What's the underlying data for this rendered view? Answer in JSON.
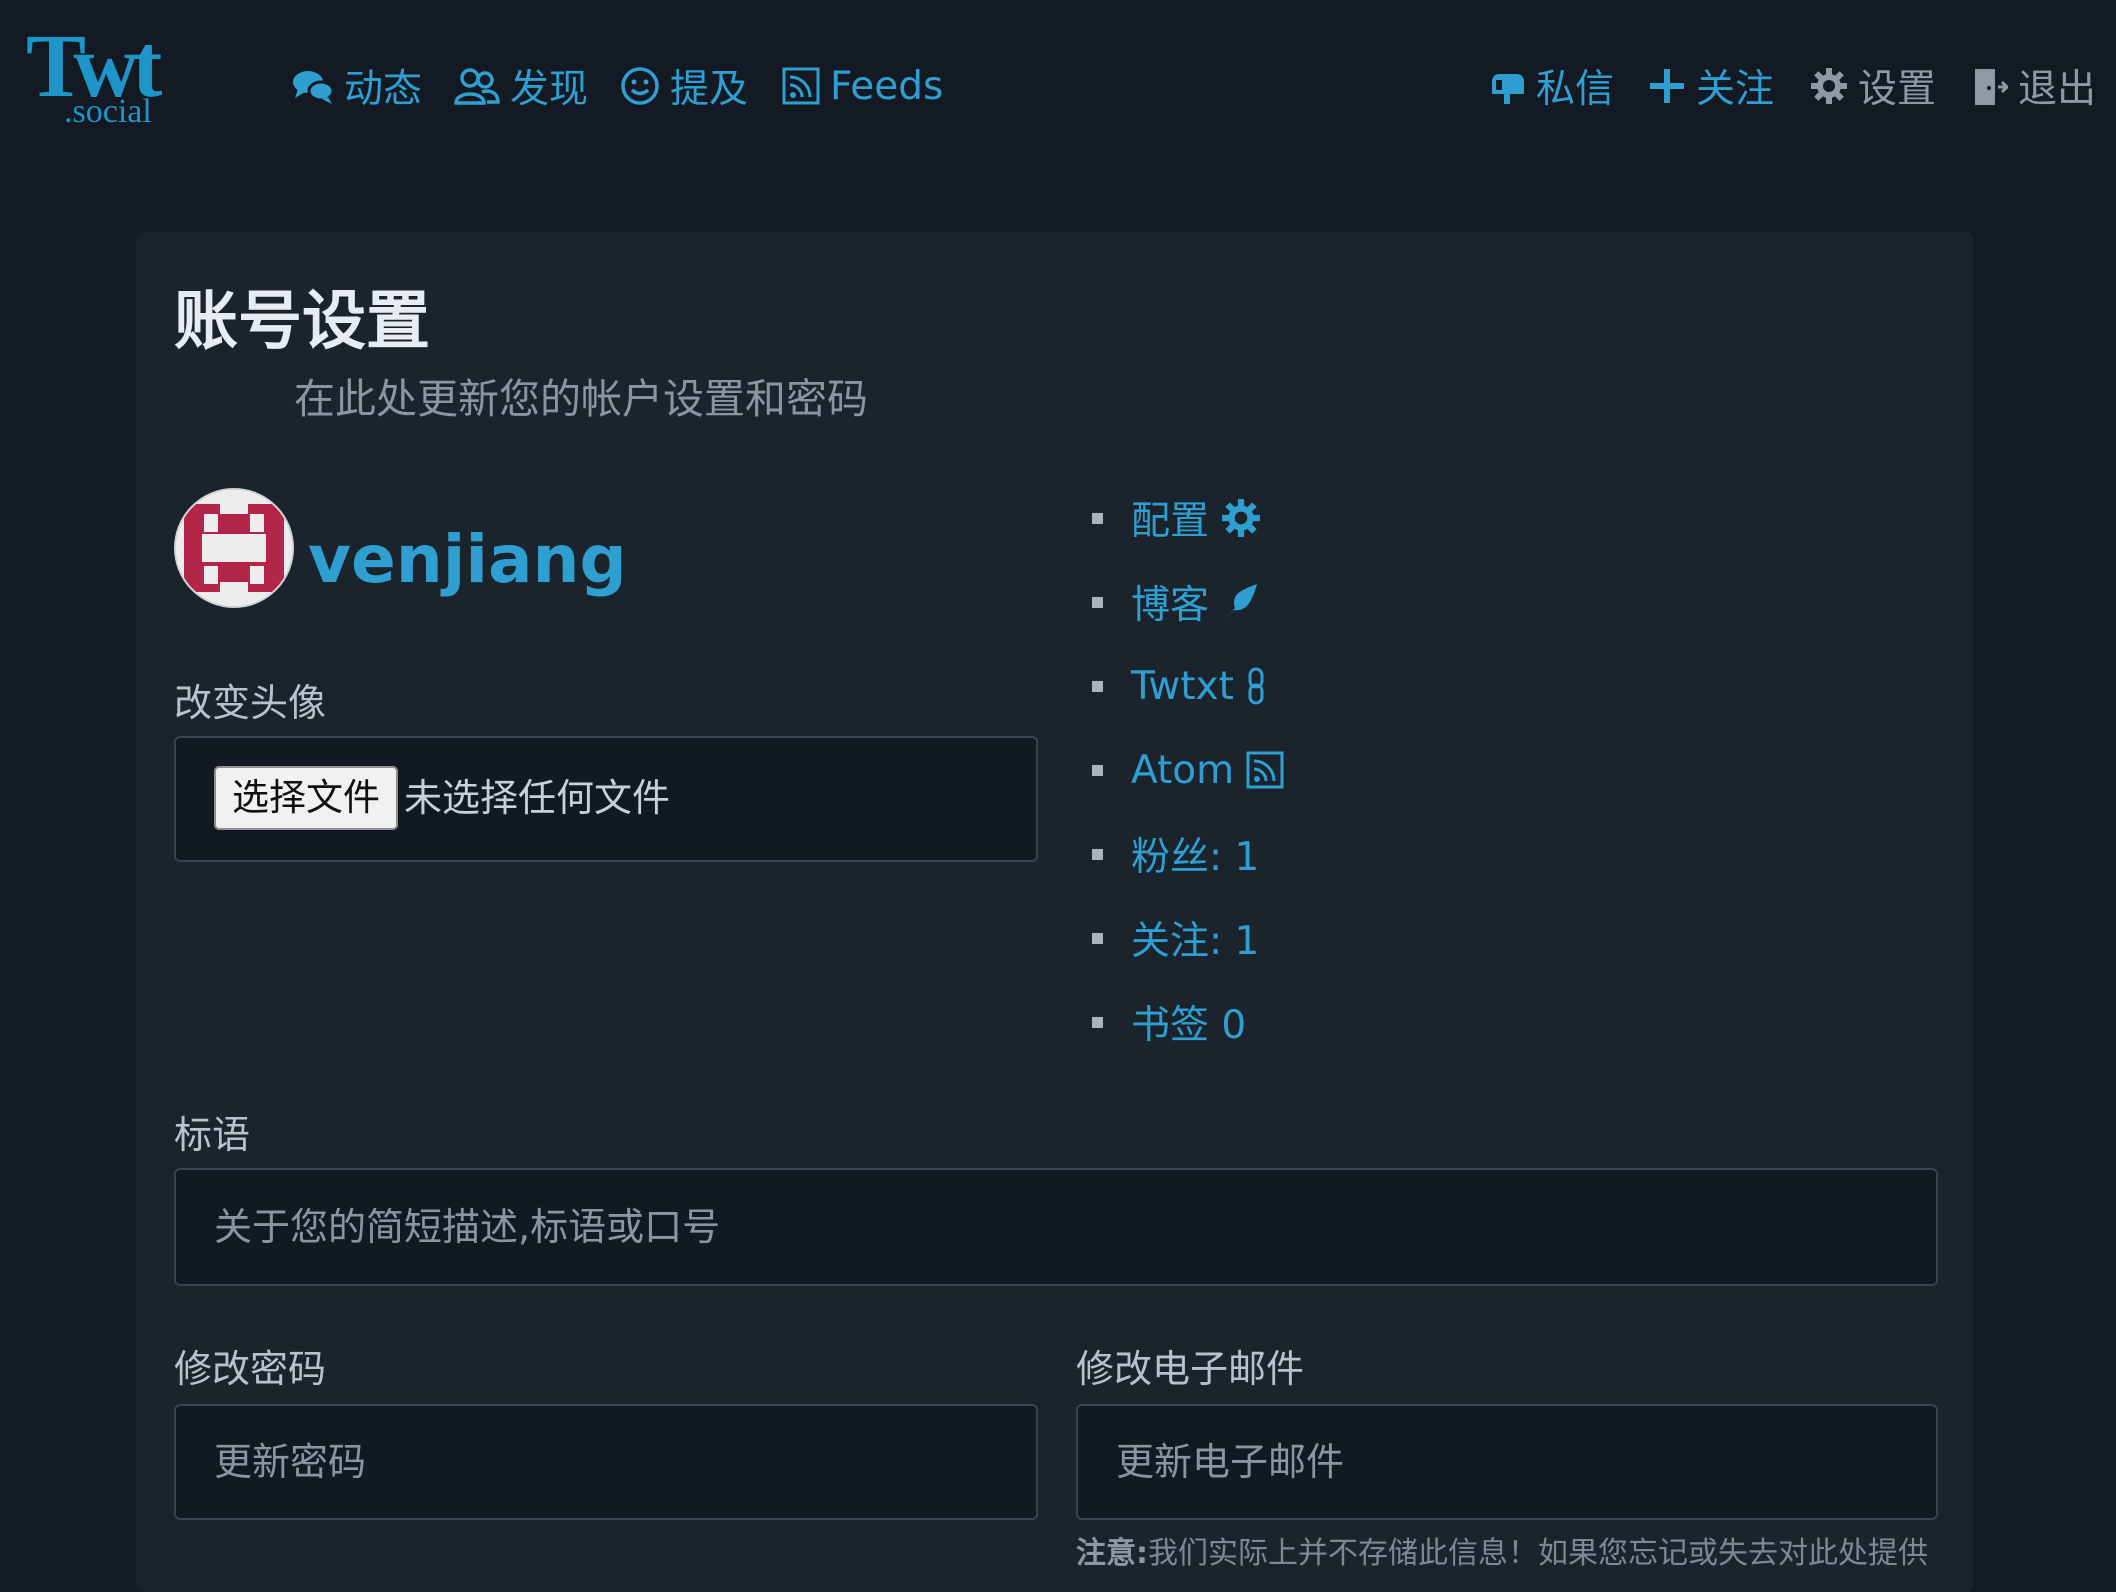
{
  "nav": {
    "logo_main": "Twt",
    "logo_sub": ".social",
    "left": [
      {
        "label": "动态",
        "icon": "chat-bubbles-icon"
      },
      {
        "label": "发现",
        "icon": "users-icon"
      },
      {
        "label": "提及",
        "icon": "smiley-icon"
      },
      {
        "label": "Feeds",
        "icon": "rss-icon"
      }
    ],
    "right": [
      {
        "label": "私信",
        "icon": "mailbox-icon"
      },
      {
        "label": "关注",
        "icon": "plus-icon"
      },
      {
        "label": "设置",
        "icon": "gear-icon"
      },
      {
        "label": "退出",
        "icon": "door-exit-icon"
      }
    ]
  },
  "settings": {
    "title": "账号设置",
    "subtitle": "在此处更新您的帐户设置和密码",
    "username": "venjiang",
    "avatar_label": "改变头像",
    "file_button": "选择文件",
    "file_status": "未选择任何文件",
    "tagline_label": "标语",
    "tagline_placeholder": "关于您的简短描述,标语或口号",
    "password_label": "修改密码",
    "password_placeholder": "更新密码",
    "email_label": "修改电子邮件",
    "email_placeholder": "更新电子邮件",
    "note_bold": "注意:",
    "note_text": "我们实际上并不存储此信息！如果您忘记或失去对此处提供"
  },
  "profile_links": [
    {
      "label": "配置",
      "icon": "gear-icon"
    },
    {
      "label": "博客",
      "icon": "feather-icon"
    },
    {
      "label": "Twtxt",
      "icon": "link-icon"
    },
    {
      "label": "Atom",
      "icon": "rss-icon"
    },
    {
      "label": "粉丝: 1",
      "icon": ""
    },
    {
      "label": "关注: 1",
      "icon": ""
    },
    {
      "label": "书签 0",
      "icon": ""
    }
  ],
  "colors": {
    "background": "#141a23",
    "card": "#1b242c",
    "accent": "#2f9fd1",
    "avatar_red": "#b3264a"
  }
}
